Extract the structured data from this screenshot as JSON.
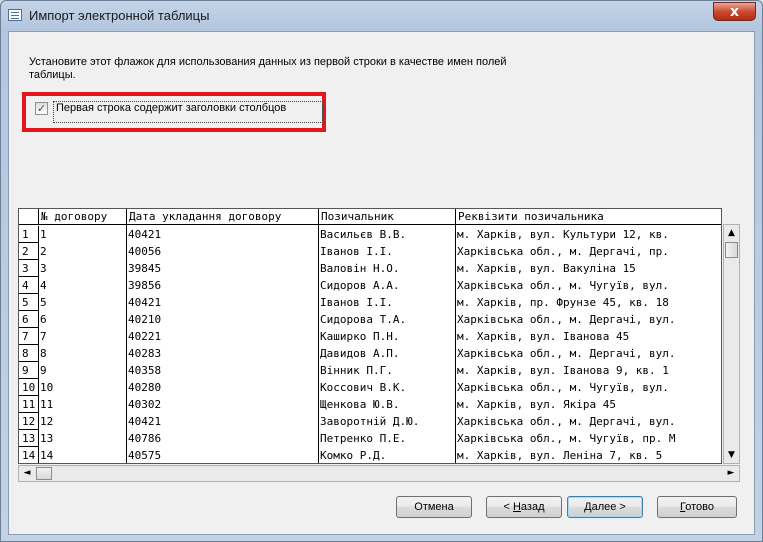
{
  "window": {
    "title": "Импорт электронной таблицы",
    "close_glyph": "x"
  },
  "instruction": "Установите этот флажок для использования данных из первой строки в качестве имен полей таблицы.",
  "checkbox": {
    "checked": true,
    "mark": "✓",
    "label": "Первая строка содержит заголовки столбцов"
  },
  "table": {
    "columns": [
      "№ договору",
      "Дата укладання договору",
      "Позичальник",
      "Реквізити позичальника"
    ],
    "row_numbers": [
      "1",
      "2",
      "3",
      "4",
      "5",
      "6",
      "7",
      "8",
      "9",
      "10",
      "11",
      "12",
      "13",
      "14"
    ],
    "rows": [
      [
        "1",
        "40421",
        "Васильєв В.В.",
        "м. Харків, вул. Культури 12, кв."
      ],
      [
        "2",
        "40056",
        "Іванов І.І.",
        "Харківська обл., м. Дергачі, пр."
      ],
      [
        "3",
        "39845",
        "Валовін Н.О.",
        "м. Харків, вул. Вакуліна 15"
      ],
      [
        "4",
        "39856",
        "Сидоров А.А.",
        "Харківська обл., м. Чугуїв, вул."
      ],
      [
        "5",
        "40421",
        "Іванов І.І.",
        "м. Харків, пр. Фрунзе 45, кв. 18"
      ],
      [
        "6",
        "40210",
        "Сидорова Т.А.",
        "Харківська обл., м. Дергачі, вул."
      ],
      [
        "7",
        "40221",
        "Каширко П.Н.",
        "м. Харків, вул. Іванова 45"
      ],
      [
        "8",
        "40283",
        "Давидов А.П.",
        "Харківська обл., м. Дергачі, вул."
      ],
      [
        "9",
        "40358",
        "Вінник П.Г.",
        "м. Харків, вул. Іванова 9, кв. 1"
      ],
      [
        "10",
        "40280",
        "Коссович В.К.",
        "Харківська обл., м. Чугуїв, вул."
      ],
      [
        "11",
        "40302",
        "Щенкова Ю.В.",
        "м. Харків, вул. Якіра 45"
      ],
      [
        "12",
        "40421",
        "Заворотній  Д.Ю.",
        "Харківська обл., м. Дергачі, вул."
      ],
      [
        "13",
        "40786",
        "Петренко П.Е.",
        "Харківська обл., м. Чугуїв, пр. М"
      ],
      [
        "14",
        "40575",
        "Комко Р.Д.",
        "м. Харків, вул. Леніна 7, кв. 5"
      ]
    ]
  },
  "scroll": {
    "up": "▲",
    "down": "▼",
    "left": "◄",
    "right": "►"
  },
  "buttons": {
    "cancel": "Отмена",
    "back_pre": "< ",
    "back_key": "Н",
    "back_post": "азад",
    "next_pre": "",
    "next_key": "Д",
    "next_post": "алее >",
    "finish_pre": "",
    "finish_key": "Г",
    "finish_post": "отово"
  }
}
